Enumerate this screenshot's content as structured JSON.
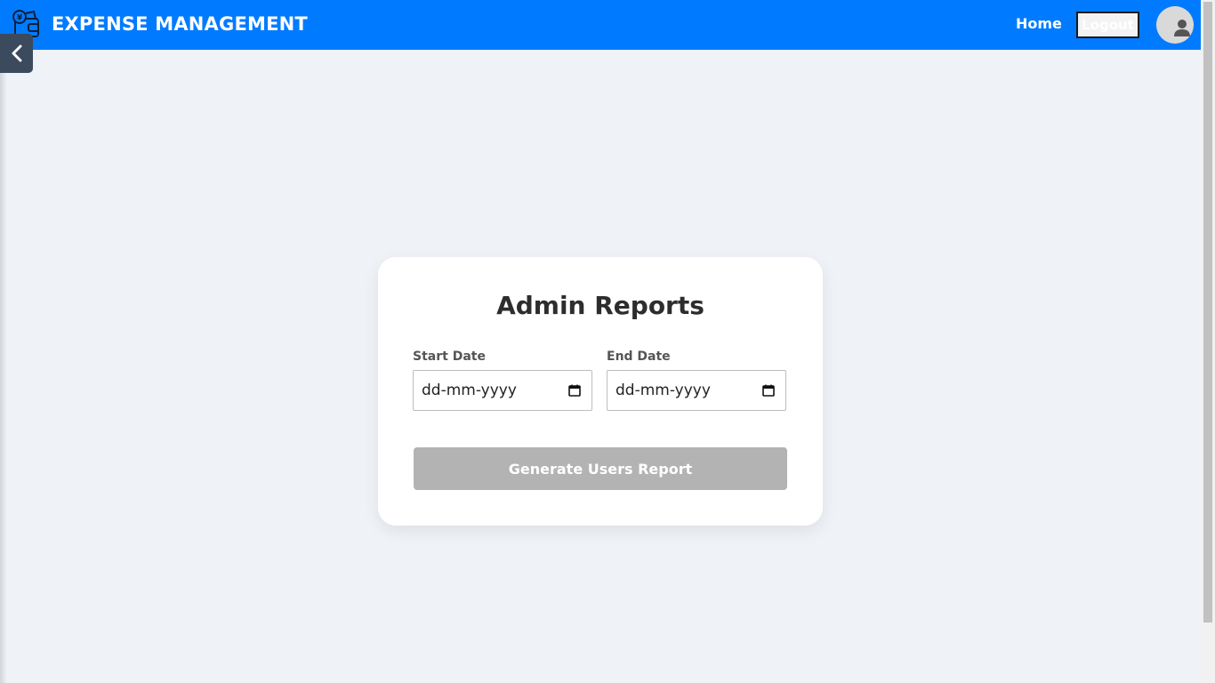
{
  "header": {
    "brand_title": "EXPENSE MANAGEMENT",
    "brand_icon": "wallet-icon",
    "nav_home": "Home",
    "nav_logout": "Logout",
    "avatar_icon": "user-icon",
    "accent_color": "#007bff"
  },
  "sidebar": {
    "toggle_icon": "chevron-left-icon"
  },
  "card": {
    "title": "Admin Reports",
    "start_date": {
      "label": "Start Date",
      "placeholder": "dd-mm-yyyy",
      "icon": "calendar-icon"
    },
    "end_date": {
      "label": "End Date",
      "placeholder": "dd-mm-yyyy",
      "icon": "calendar-icon"
    },
    "generate_button": "Generate Users Report",
    "button_color": "#b3b3b3"
  },
  "page_background": "#eff2f7"
}
